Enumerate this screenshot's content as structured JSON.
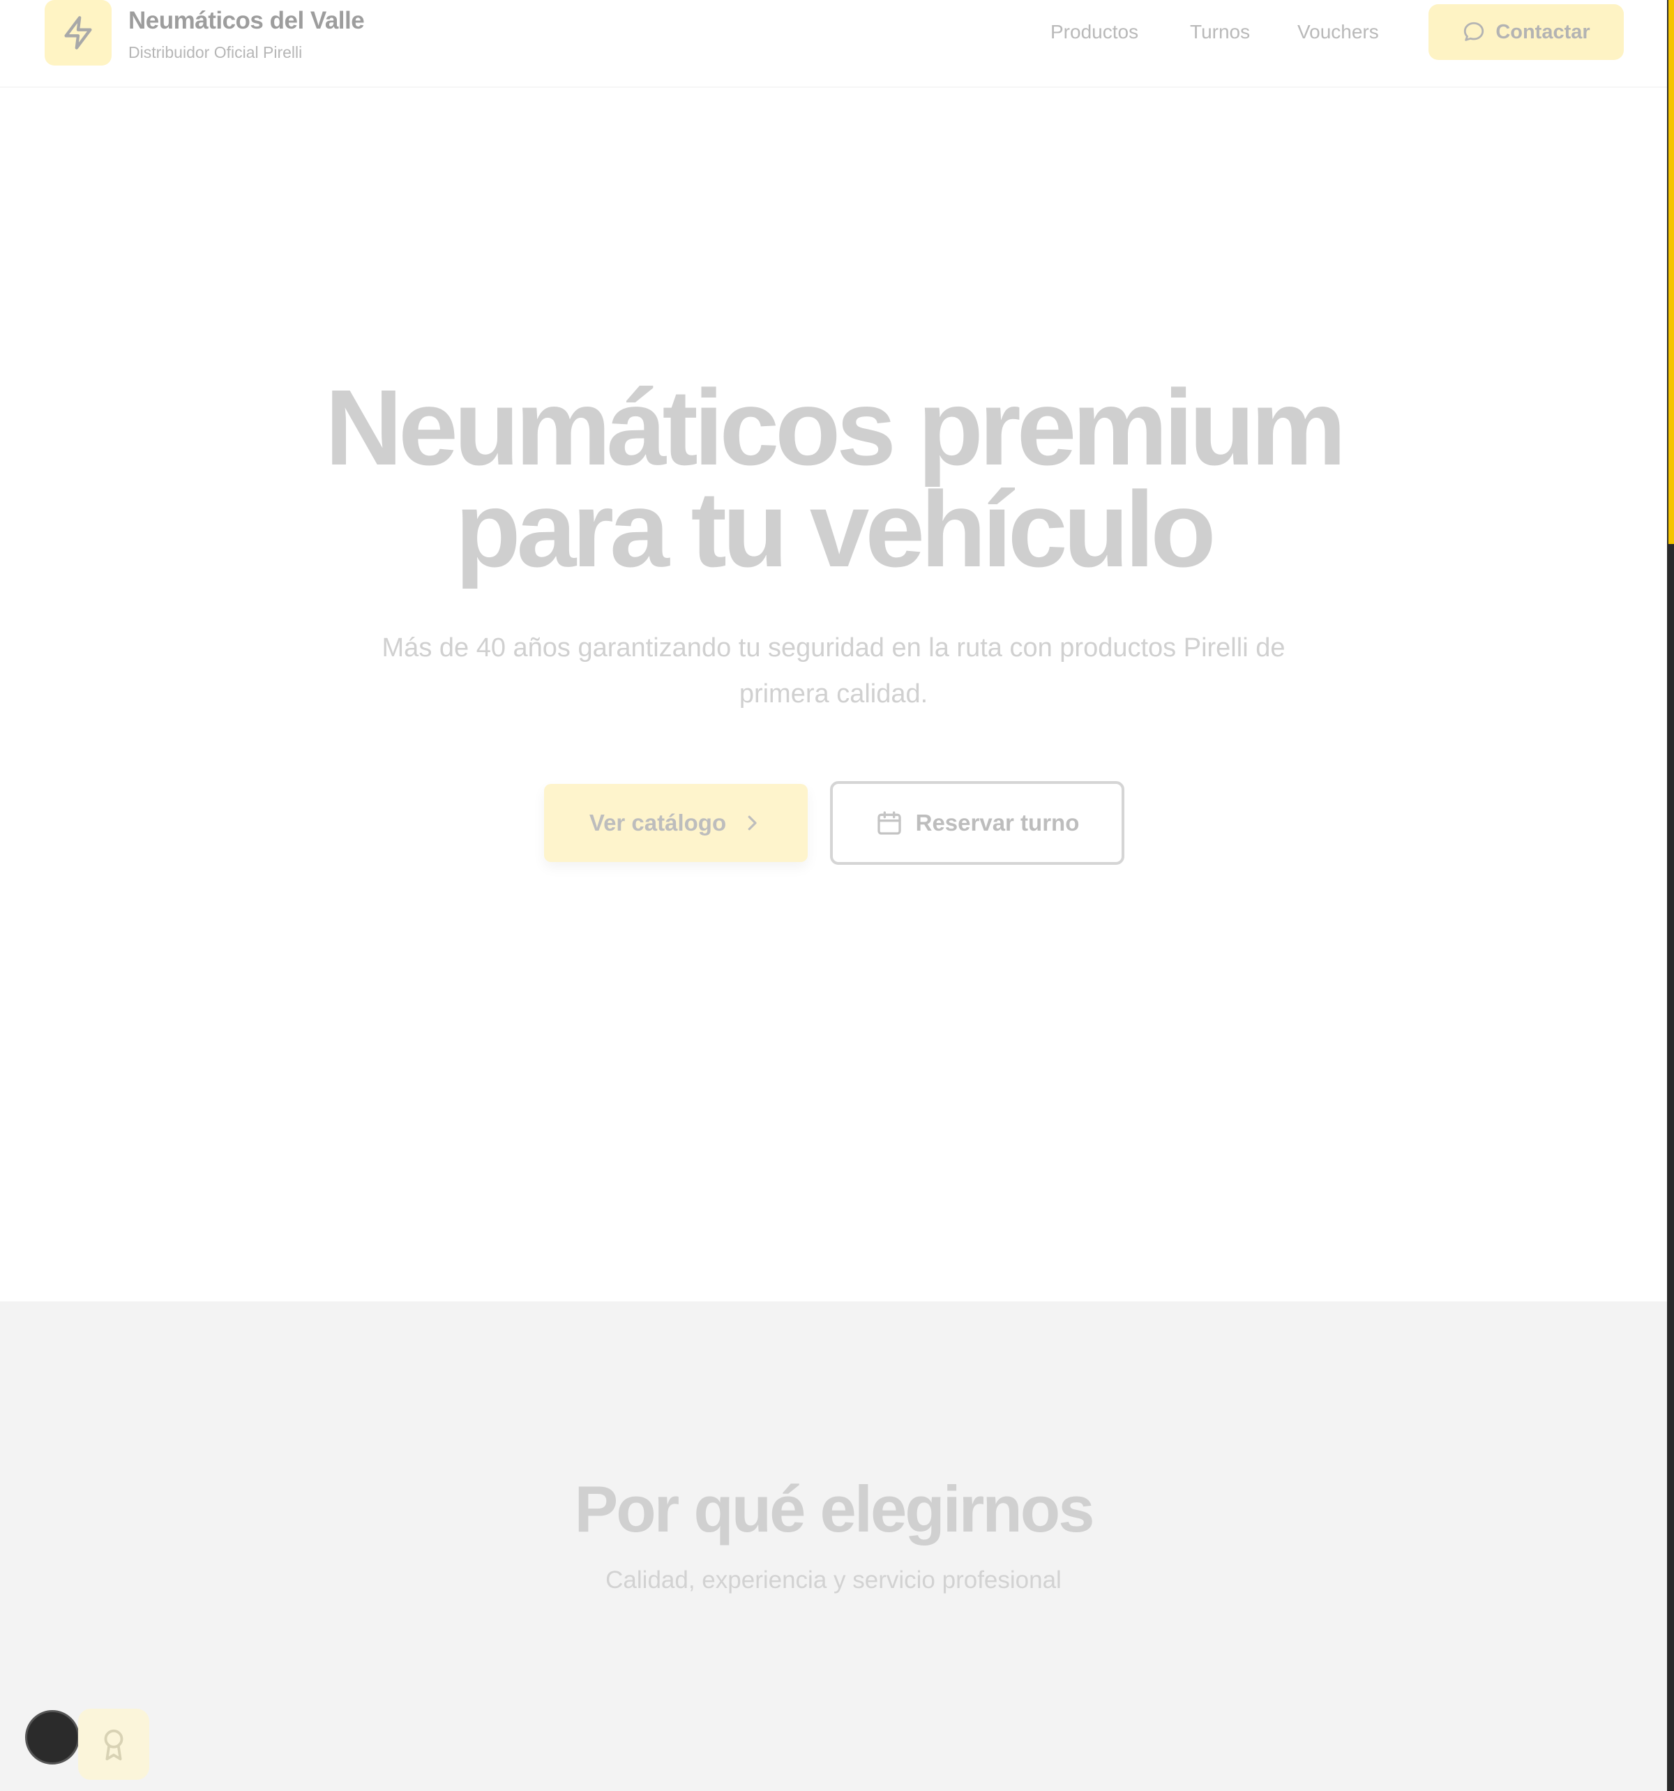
{
  "header": {
    "brand_name": "Neumáticos del Valle",
    "brand_sub": "Distribuidor Oficial Pirelli",
    "logo_icon": "lightning-bolt-icon",
    "nav": [
      {
        "label": "Productos"
      },
      {
        "label": "Turnos"
      },
      {
        "label": "Vouchers"
      }
    ],
    "contact_label": "Contactar",
    "contact_icon": "chat-bubble-icon"
  },
  "hero": {
    "title_line1": "Neumáticos premium",
    "title_line2": "para tu vehículo",
    "subtitle": "Más de 40 años garantizando tu seguridad en la ruta con productos Pirelli de primera calidad.",
    "catalog_label": "Ver catálogo",
    "turno_label": "Reservar turno"
  },
  "features": {
    "title": "Por qué elegirnos",
    "subtitle": "Calidad, experiencia y servicio profesional"
  },
  "colors": {
    "accent": "#fef3c4",
    "scroll_accent": "#f5c400",
    "section_bg": "#f3f3f3"
  }
}
